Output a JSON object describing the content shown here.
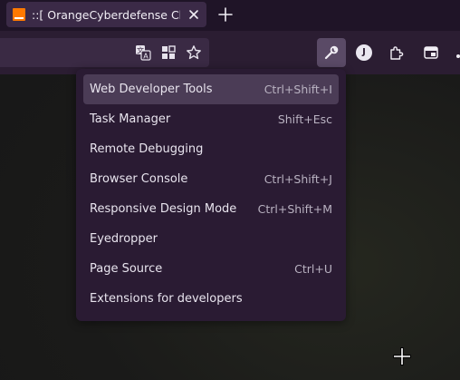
{
  "tab": {
    "title": "::[ OrangeCyberdefense Chat",
    "favicon": "orange-logo-icon",
    "close_icon": "close-icon",
    "favicon_color": "#ff7900"
  },
  "toolbar": {
    "url_icons": [
      "translate-icon",
      "extensions-grid-icon",
      "star-icon"
    ],
    "buttons": [
      "wrench-icon",
      "account-avatar-icon",
      "extension-puzzle-icon",
      "sidebar-panel-icon"
    ],
    "avatar_initial": "J"
  },
  "menu": {
    "items": [
      {
        "label": "Web Developer Tools",
        "shortcut": "Ctrl+Shift+I"
      },
      {
        "label": "Task Manager",
        "shortcut": "Shift+Esc"
      },
      {
        "label": "Remote Debugging",
        "shortcut": ""
      },
      {
        "label": "Browser Console",
        "shortcut": "Ctrl+Shift+J"
      },
      {
        "label": "Responsive Design Mode",
        "shortcut": "Ctrl+Shift+M"
      },
      {
        "label": "Eyedropper",
        "shortcut": ""
      },
      {
        "label": "Page Source",
        "shortcut": "Ctrl+U"
      },
      {
        "label": "Extensions for developers",
        "shortcut": ""
      }
    ],
    "highlighted_label": "Web Developer Tools"
  },
  "colors": {
    "accent": "#ff7900",
    "menu_bg": "#2a1b33",
    "highlight": "#4b3c56",
    "toolbar_bg": "#2b1d32"
  }
}
